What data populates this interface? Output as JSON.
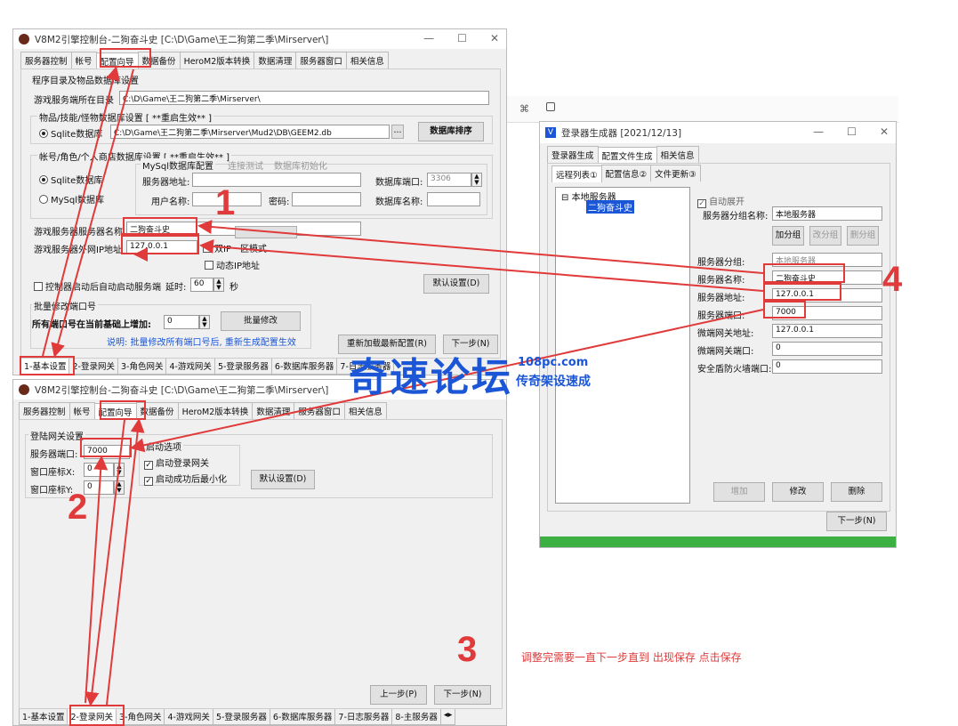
{
  "win1": {
    "title": "V8M2引擎控制台-二狗奋斗史 [C:\\D\\Game\\王二狗第二季\\Mirserver\\]",
    "tabs": [
      "服务器控制",
      "帐号",
      "配置向导",
      "数据备份",
      "HeroM2版本转换",
      "数据清理",
      "服务器窗口",
      "相关信息"
    ],
    "group_dirs": "程序目录及物品数据库设置",
    "game_dir_label": "游戏服务端所在目录",
    "game_dir_value": "C:\\D\\Game\\王二狗第二季\\Mirserver\\",
    "item_db_title": "物品/技能/怪物数据库设置 [ **重启生效** ]",
    "sqlite_db_label": "Sqlite数据库",
    "sqlite_db_value": "C:\\D\\Game\\王二狗第二季\\Mirserver\\Mud2\\DB\\GEEM2.db",
    "ellipsis": "...",
    "db_sort_btn": "数据库排序",
    "account_db_title": "帐号/角色/个人商店数据库设置 [ **重启生效** ]",
    "sqlite_radio": "Sqlite数据库",
    "mysql_radio": "MySql数据库",
    "mysql_group": "MySql数据库配置",
    "conn_test": "连接测试",
    "db_init": "数据库初始化",
    "server_addr": "服务器地址:",
    "db_port": "数据库端口:",
    "db_port_value": "3306",
    "username": "用户名称:",
    "password": "密码:",
    "db_name": "数据库名称:",
    "server_name_label": "游戏服务器服务器名称",
    "server_name_value": "二狗奋斗史",
    "ip_label": "游戏服务器外网IP地址",
    "ip_value": "127.0.0.1",
    "region_mode": "双IP一区模式",
    "dynamic_ip": "动态IP地址",
    "auto_start": "控制器启动后自动启动服务端",
    "delay_label": "延时:",
    "delay_value": "60",
    "sec": "秒",
    "default_btn": "默认设置(D)",
    "batch_title": "批量修改端口号",
    "batch_label": "所有端口号在当前基础上增加:",
    "batch_value": "0",
    "batch_btn": "批量修改",
    "batch_note": "说明: 批量修改所有端口号后, 重新生成配置生效",
    "reload_btn": "重新加载最新配置(R)",
    "next_btn": "下一步(N)",
    "bottom_tabs": [
      "1-基本设置",
      "2-登录网关",
      "3-角色网关",
      "4-游戏网关",
      "5-登录服务器",
      "6-数据库服务器",
      "7-日志服务器"
    ]
  },
  "win2": {
    "title": "V8M2引擎控制台-二狗奋斗史 [C:\\D\\Game\\王二狗第二季\\Mirserver\\]",
    "tabs": [
      "服务器控制",
      "帐号",
      "配置向导",
      "数据备份",
      "HeroM2版本转换",
      "数据清理",
      "服务器窗口",
      "相关信息"
    ],
    "group": "登陆网关设置",
    "port_label": "服务器端口:",
    "port_value": "7000",
    "winx_label": "窗口座标X:",
    "winx_value": "0",
    "winy_label": "窗口座标Y:",
    "winy_value": "0",
    "start_group": "启动选项",
    "start_gate": "启动登录网关",
    "minimize": "启动成功后最小化",
    "default_btn": "默认设置(D)",
    "prev_btn": "上一步(P)",
    "next_btn": "下一步(N)",
    "bottom_tabs": [
      "1-基本设置",
      "2-登录网关",
      "3-角色网关",
      "4-游戏网关",
      "5-登录服务器",
      "6-数据库服务器",
      "7-日志服务器",
      "8-主服务器"
    ]
  },
  "bg_toolbar": {
    "cmd": "⌘",
    "lock": "🔒"
  },
  "win3": {
    "title": "登录器生成器 [2021/12/13]",
    "tabs": [
      "登录器生成",
      "配置文件生成",
      "相关信息"
    ],
    "subtabs": [
      "远程列表①",
      "配置信息②",
      "文件更新③"
    ],
    "tree_root": "本地服务器",
    "tree_child": "二狗奋斗史",
    "auto_expand": "自动展开",
    "group_name_label": "服务器分组名称:",
    "group_name_value": "本地服务器",
    "add_group": "加分组",
    "edit_group": "改分组",
    "del_group": "删分组",
    "srv_group_label": "服务器分组:",
    "srv_group_value": "本地服务器",
    "srv_name_label": "服务器名称:",
    "srv_name_value": "二狗奋斗史",
    "srv_addr_label": "服务器地址:",
    "srv_addr_value": "127.0.0.1",
    "srv_port_label": "服务器端口:",
    "srv_port_value": "7000",
    "micro_addr_label": "微端网关地址:",
    "micro_addr_value": "127.0.0.1",
    "micro_port_label": "微端网关端口:",
    "micro_port_value": "0",
    "firewall_label": "安全盾防火墙端口:",
    "firewall_value": "0",
    "add_btn": "增加",
    "edit_btn": "修改",
    "del_btn": "删除",
    "next_btn": "下一步(N)"
  },
  "annotations": {
    "n1": "1",
    "n2": "2",
    "n3": "3",
    "n4": "4",
    "note": "调整完需要一直下一步直到 出现保存 点击保存",
    "watermark_main": "奇速论坛",
    "watermark_site": "108pc.com",
    "watermark_sub": "传奇架设速成"
  },
  "colors": {
    "red": "#e03a3a",
    "blue": "#1a56d6",
    "green": "#3cb043"
  }
}
